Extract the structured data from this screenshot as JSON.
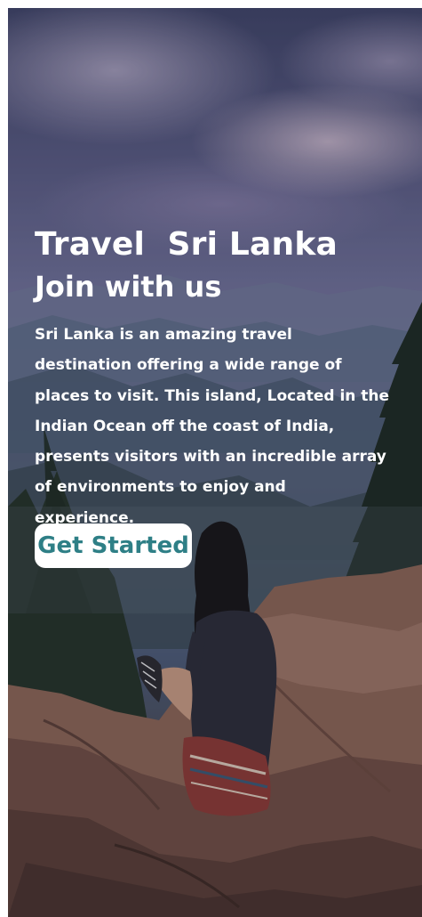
{
  "hero": {
    "title": "Travel  Sri Lanka",
    "subtitle": "Join with us",
    "description": "Sri Lanka is an amazing travel destination offering a wide range of places to visit. This island, Located in the Indian Ocean off the coast of India, presents visitors with an incredible array of environments to enjoy and experience.",
    "cta_label": "Get Started"
  },
  "colors": {
    "text": "#ffffff",
    "button_background": "#ffffff",
    "button_text": "#2e7f86"
  }
}
